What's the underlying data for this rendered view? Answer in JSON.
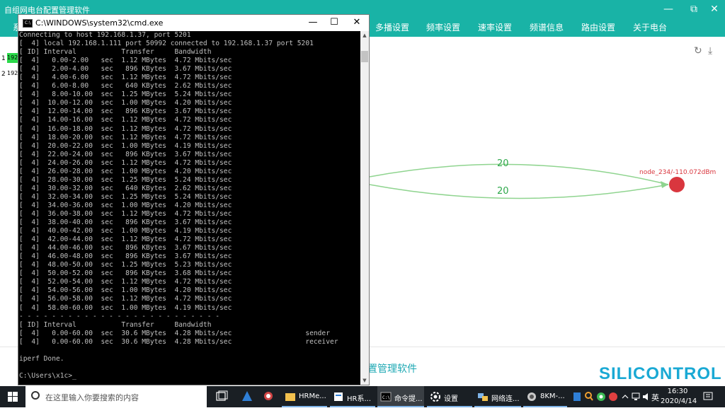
{
  "app": {
    "title": "自组网电台配置管理软件",
    "nav_left": "系",
    "nav": [
      "多播设置",
      "频率设置",
      "速率设置",
      "频谱信息",
      "路由设置",
      "关于电台"
    ],
    "rows": [
      {
        "num": "1",
        "value": "192"
      },
      {
        "num": "2",
        "value": "192"
      }
    ],
    "graph": {
      "node_label": "node_234/-110.072dBm",
      "edge_labels": [
        "20",
        "20"
      ],
      "node_color": "#d9363e",
      "edge_color": "#8fd48f",
      "edge_label_color": "#2ea84a"
    },
    "footer_title": "置管理软件",
    "logo": "SILICONTROL"
  },
  "cmd": {
    "title": "C:\\WINDOWS\\system32\\cmd.exe",
    "lines": [
      "Connecting to host 192.168.1.37, port 5201",
      "[  4] local 192.168.1.111 port 50992 connected to 192.168.1.37 port 5201",
      "[ ID] Interval           Transfer     Bandwidth",
      "[  4]   0.00-2.00   sec  1.12 MBytes  4.72 Mbits/sec",
      "[  4]   2.00-4.00   sec   896 KBytes  3.67 Mbits/sec",
      "[  4]   4.00-6.00   sec  1.12 MBytes  4.72 Mbits/sec",
      "[  4]   6.00-8.00   sec   640 KBytes  2.62 Mbits/sec",
      "[  4]   8.00-10.00  sec  1.25 MBytes  5.24 Mbits/sec",
      "[  4]  10.00-12.00  sec  1.00 MBytes  4.20 Mbits/sec",
      "[  4]  12.00-14.00  sec   896 KBytes  3.67 Mbits/sec",
      "[  4]  14.00-16.00  sec  1.12 MBytes  4.72 Mbits/sec",
      "[  4]  16.00-18.00  sec  1.12 MBytes  4.72 Mbits/sec",
      "[  4]  18.00-20.00  sec  1.12 MBytes  4.72 Mbits/sec",
      "[  4]  20.00-22.00  sec  1.00 MBytes  4.19 Mbits/sec",
      "[  4]  22.00-24.00  sec   896 KBytes  3.67 Mbits/sec",
      "[  4]  24.00-26.00  sec  1.12 MBytes  4.72 Mbits/sec",
      "[  4]  26.00-28.00  sec  1.00 MBytes  4.20 Mbits/sec",
      "[  4]  28.00-30.00  sec  1.25 MBytes  5.24 Mbits/sec",
      "[  4]  30.00-32.00  sec   640 KBytes  2.62 Mbits/sec",
      "[  4]  32.00-34.00  sec  1.25 MBytes  5.24 Mbits/sec",
      "[  4]  34.00-36.00  sec  1.00 MBytes  4.20 Mbits/sec",
      "[  4]  36.00-38.00  sec  1.12 MBytes  4.72 Mbits/sec",
      "[  4]  38.00-40.00  sec   896 KBytes  3.67 Mbits/sec",
      "[  4]  40.00-42.00  sec  1.00 MBytes  4.19 Mbits/sec",
      "[  4]  42.00-44.00  sec  1.12 MBytes  4.72 Mbits/sec",
      "[  4]  44.00-46.00  sec   896 KBytes  3.67 Mbits/sec",
      "[  4]  46.00-48.00  sec   896 KBytes  3.67 Mbits/sec",
      "[  4]  48.00-50.00  sec  1.25 MBytes  5.23 Mbits/sec",
      "[  4]  50.00-52.00  sec   896 KBytes  3.68 Mbits/sec",
      "[  4]  52.00-54.00  sec  1.12 MBytes  4.72 Mbits/sec",
      "[  4]  54.00-56.00  sec  1.00 MBytes  4.20 Mbits/sec",
      "[  4]  56.00-58.00  sec  1.12 MBytes  4.72 Mbits/sec",
      "[  4]  58.00-60.00  sec  1.00 MBytes  4.19 Mbits/sec",
      "- - - - - - - - - - - - - - - - - - - - - - - - -",
      "[ ID] Interval           Transfer     Bandwidth",
      "[  4]   0.00-60.00  sec  30.6 MBytes  4.28 Mbits/sec                  sender",
      "[  4]   0.00-60.00  sec  30.6 MBytes  4.28 Mbits/sec                  receiver",
      "",
      "iperf Done.",
      "",
      "C:\\Users\\x1c>_"
    ]
  },
  "taskbar": {
    "search_placeholder": "在这里输入你要搜索的内容",
    "items": [
      {
        "label": "HRMe...",
        "icon": "folder-icon"
      },
      {
        "label": "HR系...",
        "icon": "app-icon"
      },
      {
        "label": "命令提...",
        "icon": "terminal-icon"
      },
      {
        "label": "设置",
        "icon": "gear-icon"
      },
      {
        "label": "网络连...",
        "icon": "network-icon"
      },
      {
        "label": "8KM-...",
        "icon": "app-icon"
      }
    ],
    "ime": "英",
    "time": "16:30",
    "date": "2020/4/14"
  }
}
